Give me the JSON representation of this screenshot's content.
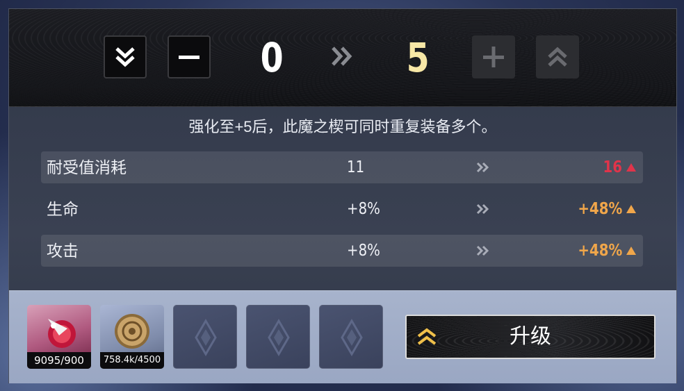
{
  "level": {
    "current": "0",
    "target": "5"
  },
  "description": "强化至+5后，此魔之楔可同时重复装备多个。",
  "stats": [
    {
      "name": "耐受值消耗",
      "from": "11",
      "to": "16",
      "to_color": "#e0344a"
    },
    {
      "name": "生命",
      "from": "+8%",
      "to": "+48%",
      "to_color": "#f0a64a"
    },
    {
      "name": "攻击",
      "from": "+8%",
      "to": "+48%",
      "to_color": "#f0a64a"
    }
  ],
  "materials": [
    {
      "icon": "red-crystal-material-icon",
      "count": "9095/900"
    },
    {
      "icon": "gold-coin-icon",
      "count": "758.4k/4500"
    }
  ],
  "upgrade_button": {
    "label": "升级"
  },
  "colors": {
    "accent_gold": "#f0c04a",
    "stat_red": "#e0344a",
    "stat_orange": "#f0a64a"
  }
}
